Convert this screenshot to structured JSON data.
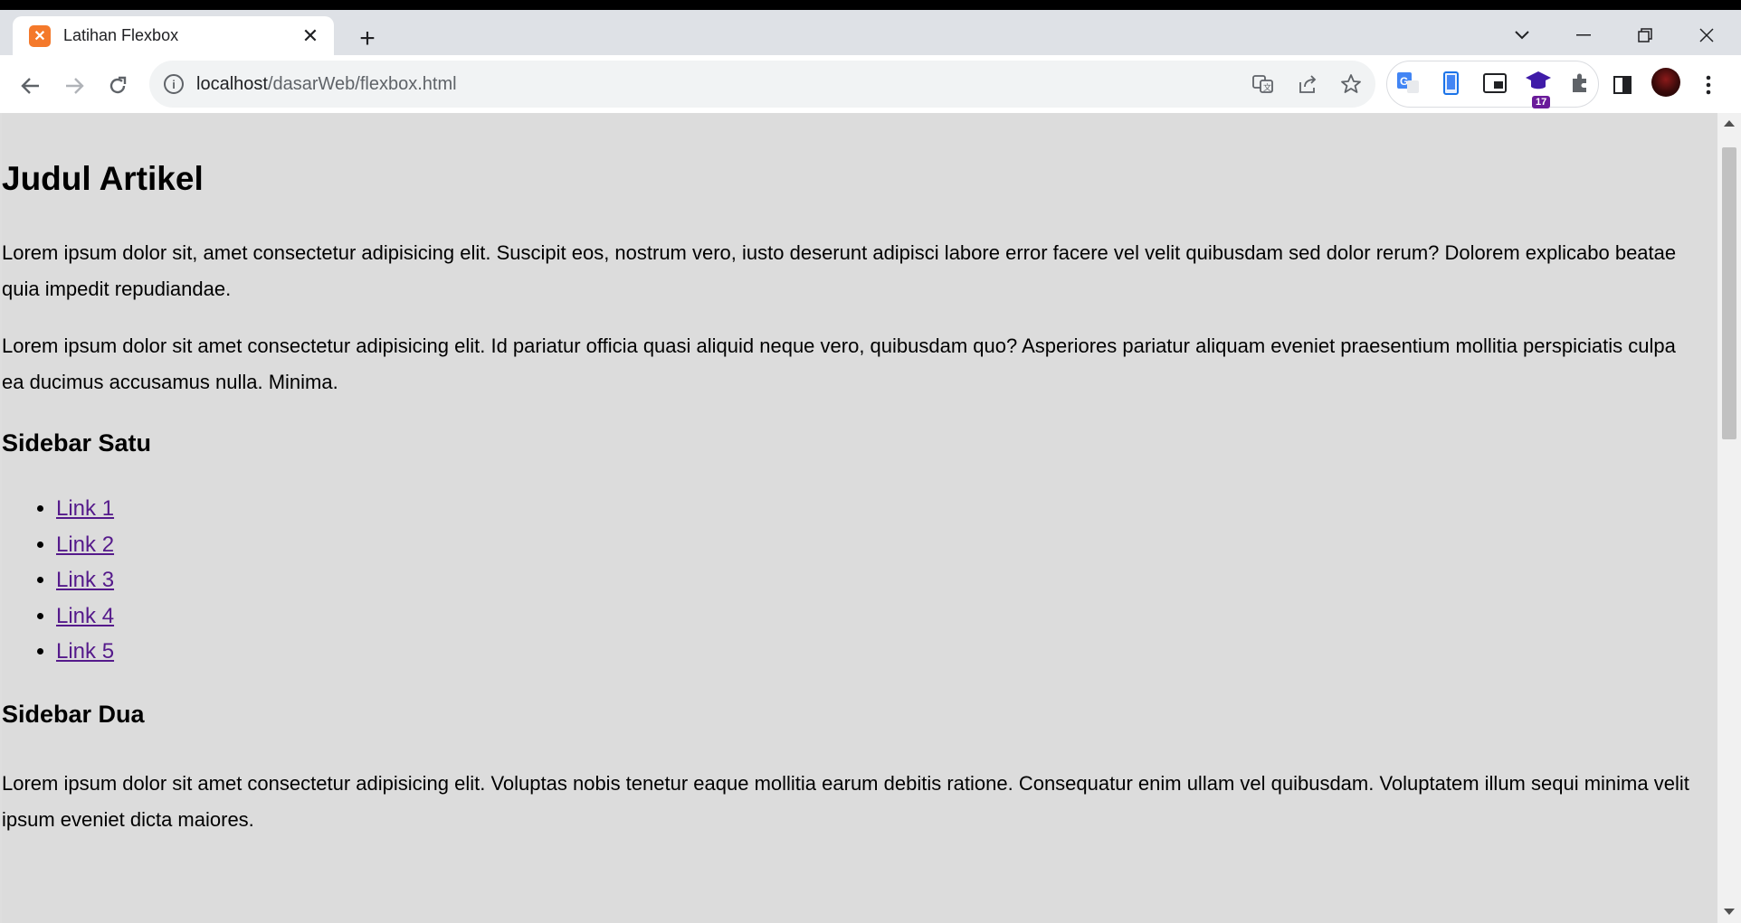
{
  "browser": {
    "tab_title": "Latihan Flexbox",
    "tab_close": "✕",
    "new_tab": "+",
    "url_host": "localhost",
    "url_path": "/dasarWeb/flexbox.html",
    "extension_badge": "17",
    "favicon_glyph": "✕",
    "accent_color": "#f4792b"
  },
  "page": {
    "heading": "Judul Artikel",
    "paragraph_1": "Lorem ipsum dolor sit, amet consectetur adipisicing elit. Suscipit eos, nostrum vero, iusto deserunt adipisci labore error facere vel velit quibusdam sed dolor rerum? Dolorem explicabo beatae quia impedit repudiandae.",
    "paragraph_2": "Lorem ipsum dolor sit amet consectetur adipisicing elit. Id pariatur officia quasi aliquid neque vero, quibusdam quo? Asperiores pariatur aliquam eveniet praesentium mollitia perspiciatis culpa ea ducimus accusamus nulla. Minima.",
    "sidebar_1_title": "Sidebar Satu",
    "links": [
      "Link 1",
      "Link 2",
      "Link 3",
      "Link 4",
      "Link 5"
    ],
    "sidebar_2_title": "Sidebar Dua",
    "paragraph_3": "Lorem ipsum dolor sit amet consectetur adipisicing elit. Voluptas nobis tenetur eaque mollitia earum debitis ratione. Consequatur enim ullam vel quibusdam. Voluptatem illum sequi minima velit ipsum eveniet dicta maiores."
  }
}
